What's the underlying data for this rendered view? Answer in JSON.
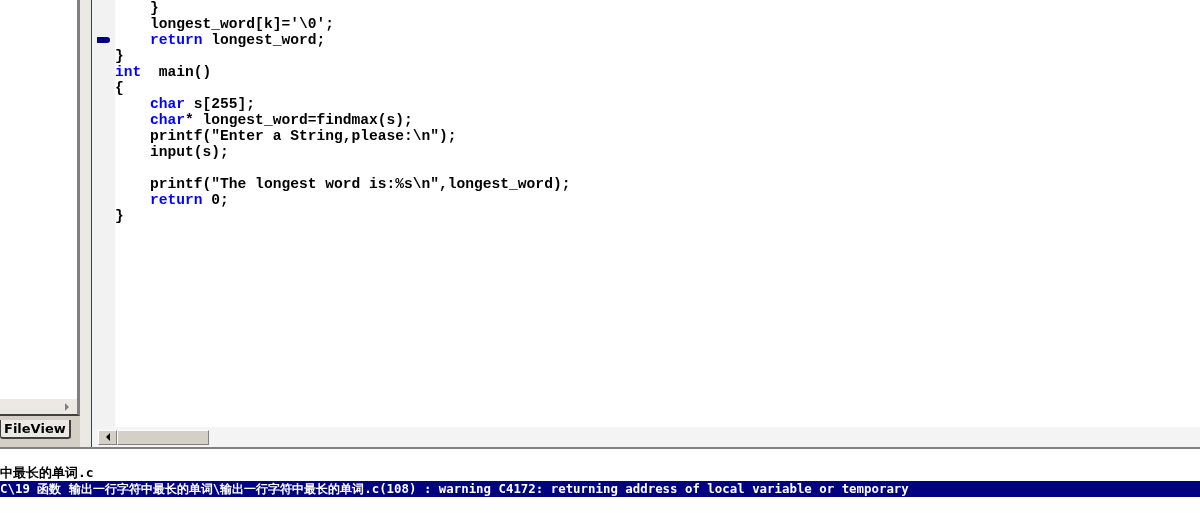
{
  "workspace": {
    "tabs": [
      {
        "label": "FileView",
        "selected": true
      }
    ]
  },
  "editor": {
    "lines": [
      {
        "segments": [
          {
            "kind": "plain",
            "text": "    }"
          }
        ]
      },
      {
        "segments": [
          {
            "kind": "plain",
            "text": "    longest_word[k]='\\0';"
          }
        ]
      },
      {
        "marker": true,
        "segments": [
          {
            "kind": "keyword",
            "text": "    return"
          },
          {
            "kind": "plain",
            "text": " longest_word;"
          }
        ]
      },
      {
        "segments": [
          {
            "kind": "plain",
            "text": "}"
          }
        ]
      },
      {
        "segments": [
          {
            "kind": "keyword",
            "text": "int"
          },
          {
            "kind": "plain",
            "text": "  main()"
          }
        ]
      },
      {
        "segments": [
          {
            "kind": "plain",
            "text": "{"
          }
        ]
      },
      {
        "segments": [
          {
            "kind": "keyword",
            "text": "    char"
          },
          {
            "kind": "plain",
            "text": " s[255];"
          }
        ]
      },
      {
        "segments": [
          {
            "kind": "keyword",
            "text": "    char"
          },
          {
            "kind": "plain",
            "text": "* longest_word=findmax(s);"
          }
        ]
      },
      {
        "segments": [
          {
            "kind": "plain",
            "text": "    printf(\"Enter a String,please:\\n\");"
          }
        ]
      },
      {
        "segments": [
          {
            "kind": "plain",
            "text": "    input(s);"
          }
        ]
      },
      {
        "blank_line_before": true,
        "segments": [
          {
            "kind": "plain",
            "text": "    printf(\"The longest word is:%s\\n\",longest_word);"
          }
        ]
      },
      {
        "segments": [
          {
            "kind": "keyword",
            "text": "    return"
          },
          {
            "kind": "plain",
            "text": " 0;"
          }
        ]
      },
      {
        "segments": [
          {
            "kind": "plain",
            "text": "}"
          }
        ]
      }
    ]
  },
  "output": {
    "lines": [
      {
        "text": "中最长的单词.c",
        "selected": false
      },
      {
        "text": "C\\19 函数 输出一行字符中最长的单词\\输出一行字符中最长的单词.c(108) : warning C4172: returning address of local variable or temporary",
        "selected": true
      }
    ]
  }
}
